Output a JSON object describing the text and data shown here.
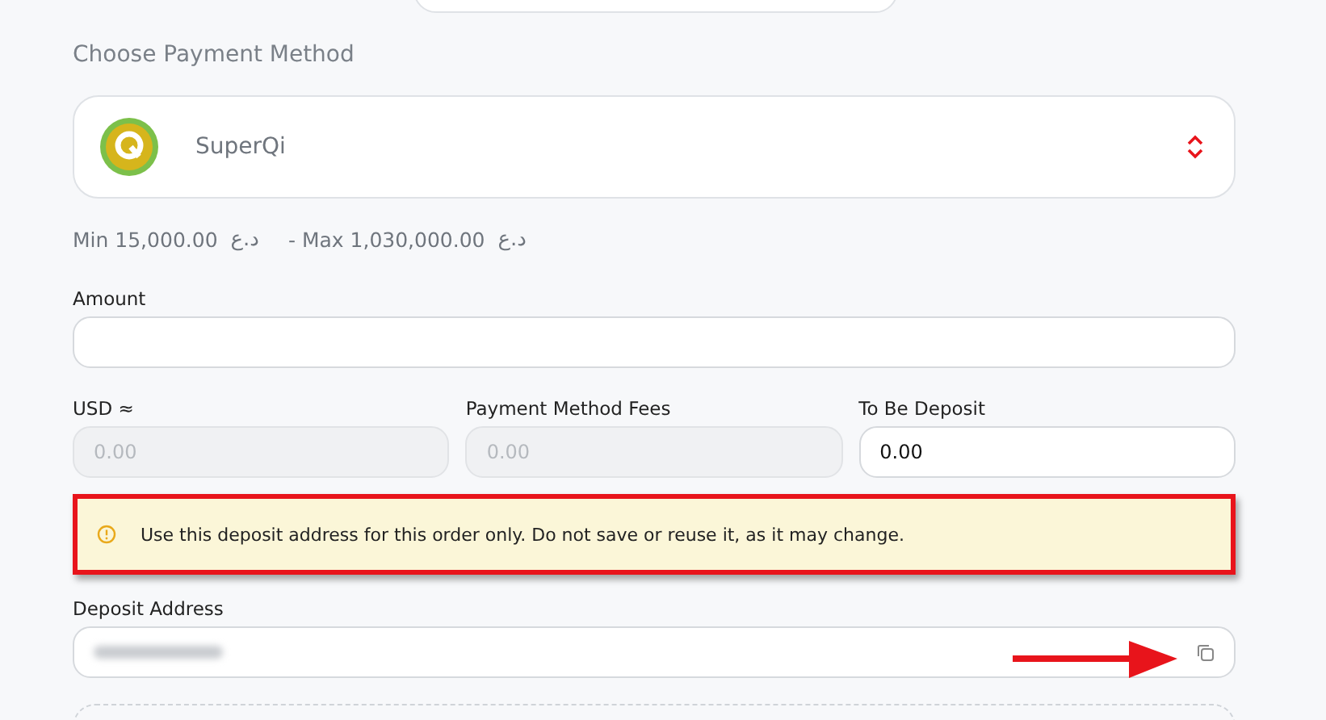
{
  "section_title": "Choose Payment Method",
  "payment_method": {
    "name": "SuperQi"
  },
  "limits": {
    "min_label": "Min 15,000.00",
    "min_currency": "د.ع",
    "separator": "- Max 1,030,000.00",
    "max_currency": "د.ع"
  },
  "amount": {
    "label": "Amount"
  },
  "fields": [
    {
      "label": "USD ≈",
      "placeholder": "0.00",
      "disabled": true
    },
    {
      "label": "Payment Method Fees",
      "placeholder": "0.00",
      "disabled": true
    },
    {
      "label": "To Be Deposit",
      "value": "0.00",
      "disabled": false
    }
  ],
  "notice": {
    "text": "Use this deposit address for this order only. Do not save or reuse it, as it may change.",
    "highlighted": true
  },
  "deposit_address": {
    "label": "Deposit Address",
    "redacted": true
  },
  "annotation_arrow": true
}
